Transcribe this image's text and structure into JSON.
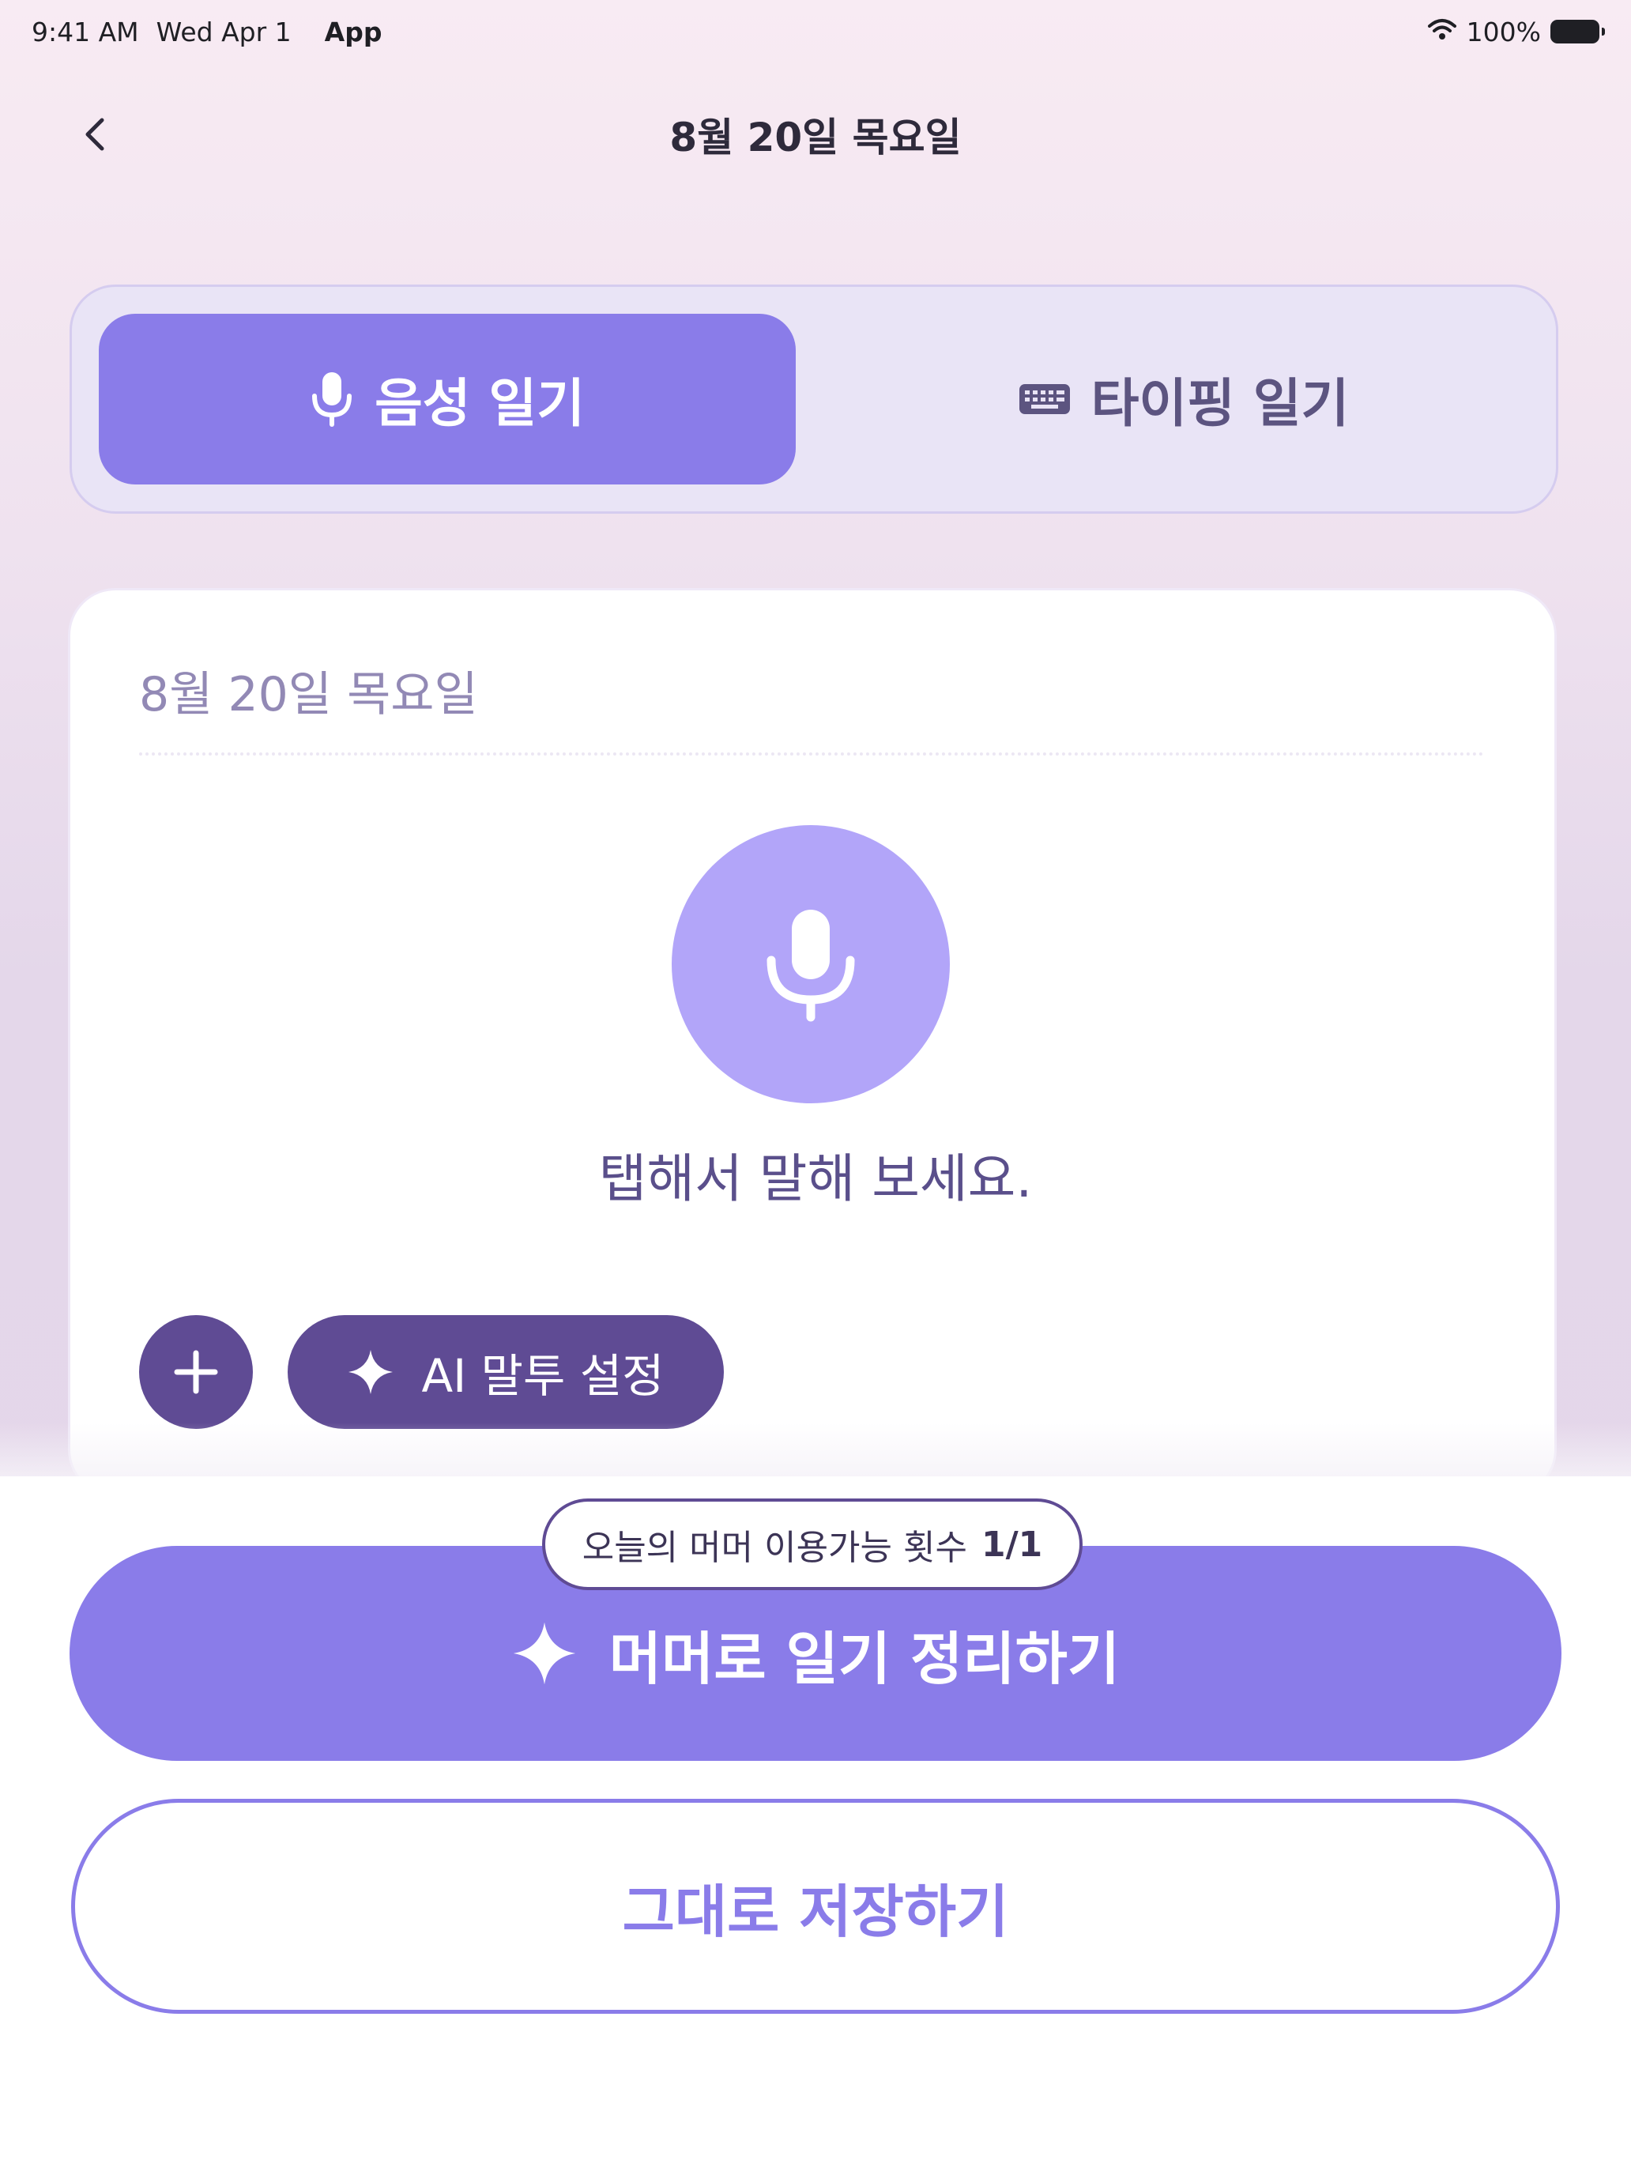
{
  "status_bar": {
    "time": "9:41 AM",
    "date": "Wed Apr 1",
    "app_label": "App",
    "battery": "100%"
  },
  "header": {
    "title": "8월 20일 목요일"
  },
  "tabs": [
    {
      "label": "음성 일기",
      "icon": "microphone-icon",
      "selected": true
    },
    {
      "label": "타이핑 일기",
      "icon": "keyboard-icon",
      "selected": false
    }
  ],
  "card": {
    "date": "8월 20일 목요일",
    "hint": "탭해서 말해 보세요.",
    "tone_button": "AI 말투 설정"
  },
  "footer": {
    "quota_label": "오늘의 머머 이용가능 횟수",
    "quota_value": "1/1",
    "primary_button": "머머로 일기 정리하기",
    "secondary_button": "그대로 저장하기"
  },
  "colors": {
    "accent": "#8a7ce9",
    "mic_circle": "#b2a5f9",
    "dark_accent": "#5f4b94"
  }
}
